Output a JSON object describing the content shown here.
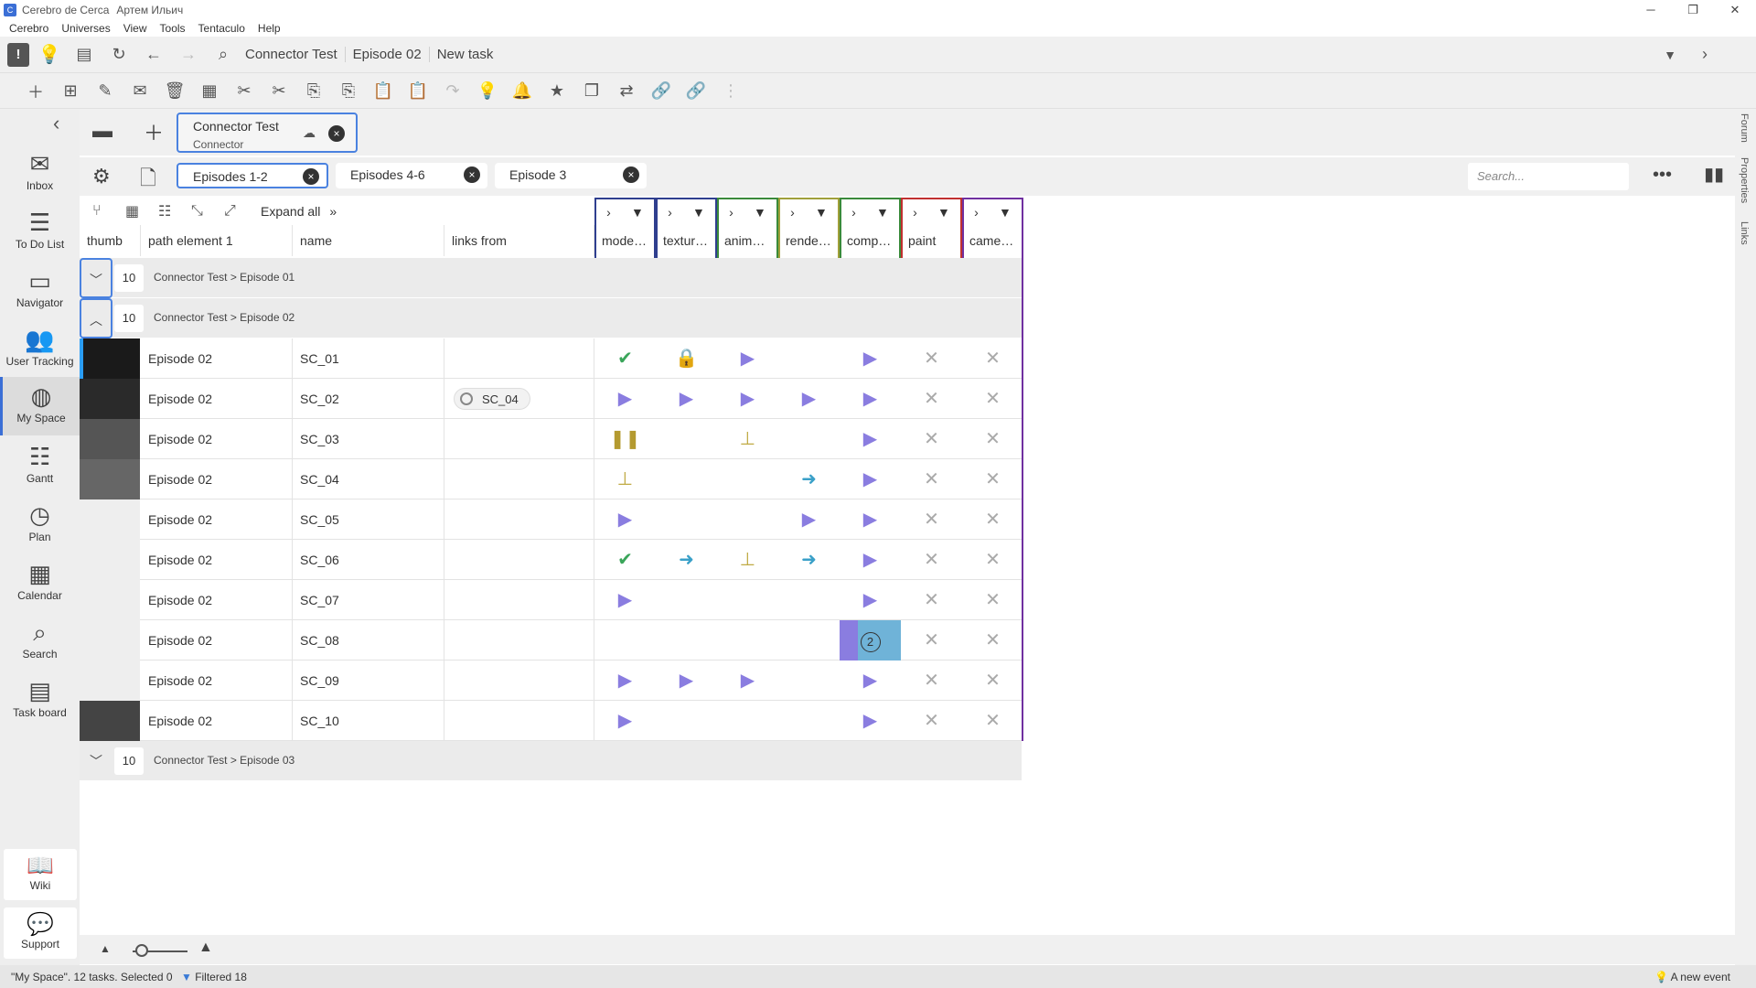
{
  "window": {
    "title": "Cerebro de Cerca",
    "user": "Артем Ильич"
  },
  "menu": [
    "Cerebro",
    "Universes",
    "View",
    "Tools",
    "Tentaculo",
    "Help"
  ],
  "breadcrumb": [
    "Connector Test",
    "Episode 02",
    "New task"
  ],
  "sidebar": {
    "items": [
      {
        "label": "Inbox",
        "icon": "mail-icon",
        "glyph": "✉"
      },
      {
        "label": "To Do List",
        "icon": "list-icon",
        "glyph": "☰"
      },
      {
        "label": "Navigator",
        "icon": "folder-icon",
        "glyph": "▭"
      },
      {
        "label": "User Tracking",
        "icon": "users-icon",
        "glyph": "👥"
      },
      {
        "label": "My Space",
        "icon": "globe-icon",
        "glyph": "◍"
      },
      {
        "label": "Gantt",
        "icon": "gantt-icon",
        "glyph": "☷"
      },
      {
        "label": "Plan",
        "icon": "clock-plus-icon",
        "glyph": "◷"
      },
      {
        "label": "Calendar",
        "icon": "calendar-icon",
        "glyph": "▦"
      },
      {
        "label": "Search",
        "icon": "search-icon",
        "glyph": "⌕"
      },
      {
        "label": "Task board",
        "icon": "clipboard-icon",
        "glyph": "▤"
      }
    ],
    "active": "My Space",
    "bottom": [
      {
        "label": "Wiki",
        "icon": "book-icon",
        "glyph": "📖"
      },
      {
        "label": "Support",
        "icon": "chat-icon",
        "glyph": "💬"
      }
    ]
  },
  "project_tab": {
    "title": "Connector Test",
    "subtitle": "Connector"
  },
  "filter_tabs": [
    {
      "label": "Episodes 1-2",
      "active": true
    },
    {
      "label": "Episodes 4-6",
      "active": false
    },
    {
      "label": "Episode 3",
      "active": false
    }
  ],
  "search": {
    "placeholder": "Search..."
  },
  "grid": {
    "expand_all": "Expand all",
    "columns": [
      "thumb",
      "path element 1",
      "name",
      "links from"
    ],
    "task_columns": [
      {
        "name": "mode…",
        "color": "#2f3f8f"
      },
      {
        "name": "textur…",
        "color": "#2f3f8f"
      },
      {
        "name": "anima…",
        "color": "#3a8a3a"
      },
      {
        "name": "rende…",
        "color": "#a0a03a"
      },
      {
        "name": "comp…",
        "color": "#3a8a3a"
      },
      {
        "name": "paint",
        "color": "#c03030"
      },
      {
        "name": "came…",
        "color": "#7030a0"
      }
    ],
    "groups": [
      {
        "count": "10",
        "name": "Connector Test > Episode 01",
        "expanded": false
      },
      {
        "count": "10",
        "name": "Connector Test > Episode 02",
        "expanded": true
      },
      {
        "count": "10",
        "name": "Connector Test > Episode 03",
        "expanded": false
      }
    ],
    "rows": [
      {
        "path": "Episode 02",
        "name": "SC_01",
        "link": "",
        "status": [
          "check",
          "lock",
          "play",
          "",
          "play",
          "x",
          "x"
        ]
      },
      {
        "path": "Episode 02",
        "name": "SC_02",
        "link": "SC_04",
        "status": [
          "play",
          "play",
          "play",
          "play",
          "play",
          "x",
          "x"
        ]
      },
      {
        "path": "Episode 02",
        "name": "SC_03",
        "link": "",
        "status": [
          "pause",
          "",
          "stamp",
          "",
          "play",
          "x",
          "x"
        ]
      },
      {
        "path": "Episode 02",
        "name": "SC_04",
        "link": "",
        "status": [
          "stamp",
          "",
          "",
          "arrow",
          "play",
          "x",
          "x"
        ]
      },
      {
        "path": "Episode 02",
        "name": "SC_05",
        "link": "",
        "status": [
          "play",
          "",
          "",
          "play",
          "play",
          "x",
          "x"
        ]
      },
      {
        "path": "Episode 02",
        "name": "SC_06",
        "link": "",
        "status": [
          "check",
          "arrow",
          "stamp",
          "arrow",
          "play",
          "x",
          "x"
        ]
      },
      {
        "path": "Episode 02",
        "name": "SC_07",
        "link": "",
        "status": [
          "play",
          "",
          "",
          "",
          "play",
          "x",
          "x"
        ]
      },
      {
        "path": "Episode 02",
        "name": "SC_08",
        "link": "",
        "status": [
          "",
          "",
          "",
          "",
          "badge",
          "x",
          "x"
        ]
      },
      {
        "path": "Episode 02",
        "name": "SC_09",
        "link": "",
        "status": [
          "play",
          "play",
          "play",
          "",
          "play",
          "x",
          "x"
        ]
      },
      {
        "path": "Episode 02",
        "name": "SC_10",
        "link": "",
        "status": [
          "play",
          "",
          "",
          "",
          "play",
          "x",
          "x"
        ]
      }
    ],
    "badge_value": "2"
  },
  "status_bar": {
    "summary": "\"My Space\". 12 tasks. Selected 0",
    "filtered": "Filtered 18",
    "event": "A new event"
  },
  "right_strip": [
    "Forum",
    "Properties",
    "Links"
  ]
}
